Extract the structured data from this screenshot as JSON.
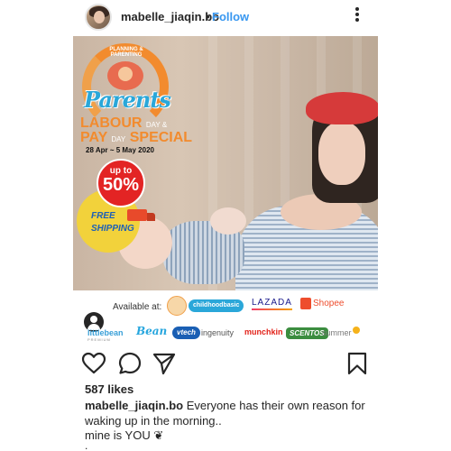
{
  "header": {
    "username": "mabelle_jiaqin.bo",
    "separator": "•",
    "follow_label": "Follow",
    "more_icon": "more-options-icon"
  },
  "post": {
    "promo": {
      "arc_text": "PLANNING & PARENTING",
      "brand": "Parents",
      "line1_big": "LABOUR",
      "line1_small": "DAY &",
      "line2_big": "PAY",
      "line2_mid": "DAY",
      "line2_end": "SPECIAL",
      "dates": "28 Apr ~ 5 May 2020",
      "badge_top": "up to",
      "badge_value": "50%",
      "shipping_free": "FREE",
      "shipping_word": "SHIPPING",
      "brand_color": "#2aa7d9",
      "accent_color": "#f28b2e",
      "badge_color": "#e32424"
    },
    "sponsors": {
      "available_label": "Available at:",
      "childhoodbasic": "childhoodbasic",
      "lazada": "LAZADA",
      "shopee": "Shopee",
      "littlebean": "littlebean",
      "littlebean_sub": "PREMIUM",
      "bean": "Bean",
      "vtech": "vtech",
      "ingenuity": "ingenuity",
      "munchkin": "munchkin",
      "scentos": "SCENTOS",
      "summer": "summer"
    },
    "tag_icon": "user-tag-icon"
  },
  "actions": {
    "like_icon": "heart-icon",
    "comment_icon": "comment-icon",
    "share_icon": "send-icon",
    "save_icon": "bookmark-icon"
  },
  "likes": "587 likes",
  "caption": {
    "username": "mabelle_jiaqin.bo",
    "text": "Everyone has their own reason for waking up in the morning..",
    "line2": "mine is YOU ❦",
    "line3": "."
  }
}
